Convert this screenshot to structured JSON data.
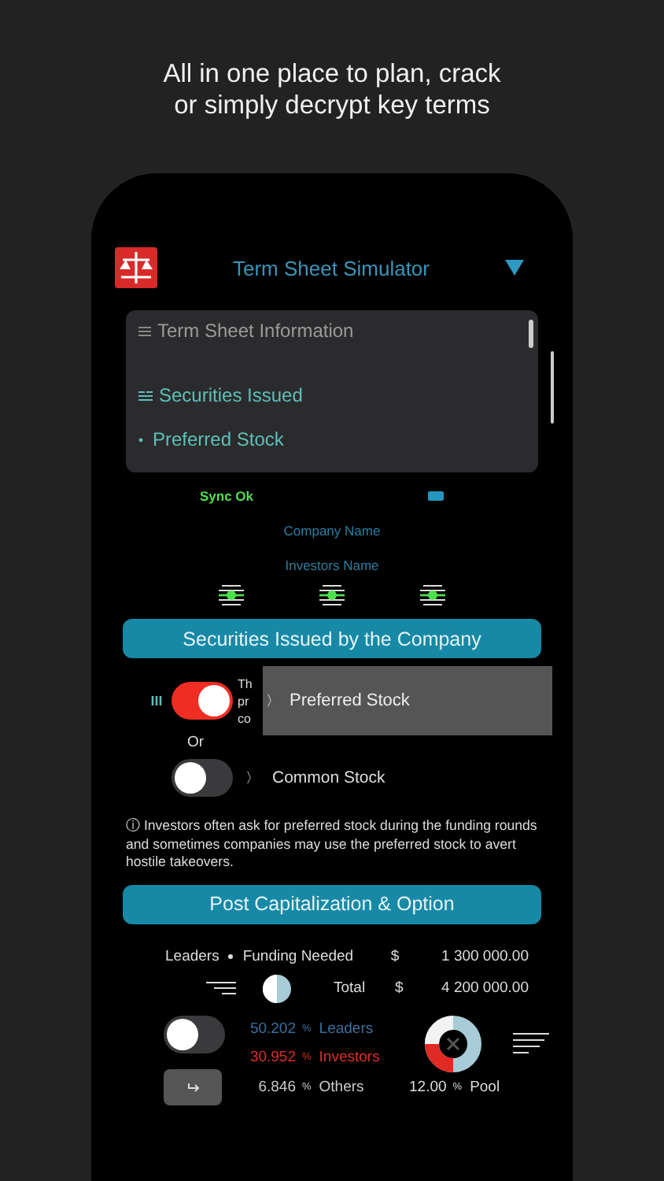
{
  "caption": "All in one place to plan, crack\nor simply decrypt key terms",
  "header": {
    "title": "Term Sheet Simulator"
  },
  "outline": [
    {
      "kind": "heading",
      "label": "Term Sheet Information"
    },
    {
      "kind": "section",
      "label": "Securities Issued"
    },
    {
      "kind": "bullet",
      "label": "Preferred Stock"
    }
  ],
  "sync_status": "Sync Ok",
  "fields": [
    {
      "placeholder": "Company Name"
    },
    {
      "placeholder": "Investors Name"
    }
  ],
  "securities_button": "Securities Issued by the Company",
  "options": [
    {
      "on": true,
      "covered_text_lines": [
        "Th",
        "pr",
        "co"
      ]
    },
    {
      "on": false,
      "chevron": "〉",
      "label": "Common Stock"
    }
  ],
  "or_label": "Or",
  "popup": {
    "chevron": "〉",
    "label": "Preferred Stock"
  },
  "note": "ⓘ Investors often ask for preferred stock during the funding rounds and sometimes companies may use the preferred stock to avert hostile takeovers.",
  "post_cap_button": "Post Capitalization & Option",
  "funding": {
    "leaders_label": "Leaders",
    "funding_label": "Funding  Needed",
    "currency": "$",
    "amount": "1 300 000.00"
  },
  "total": {
    "label": "Total",
    "currency": "$",
    "amount": "4 200 000.00"
  },
  "split_toggle": {
    "on": false
  },
  "shares": [
    {
      "value": "50.202",
      "unit": "%",
      "label": "Leaders",
      "color": "#3b6f9c"
    },
    {
      "value": "30.952",
      "unit": "%",
      "label": "Investors",
      "color": "#d9302a"
    },
    {
      "value": "6.846",
      "unit": "%",
      "label": "Others",
      "color": "#cccccc"
    }
  ],
  "pool": {
    "value": "12.00",
    "unit": "%",
    "label": "Pool"
  }
}
